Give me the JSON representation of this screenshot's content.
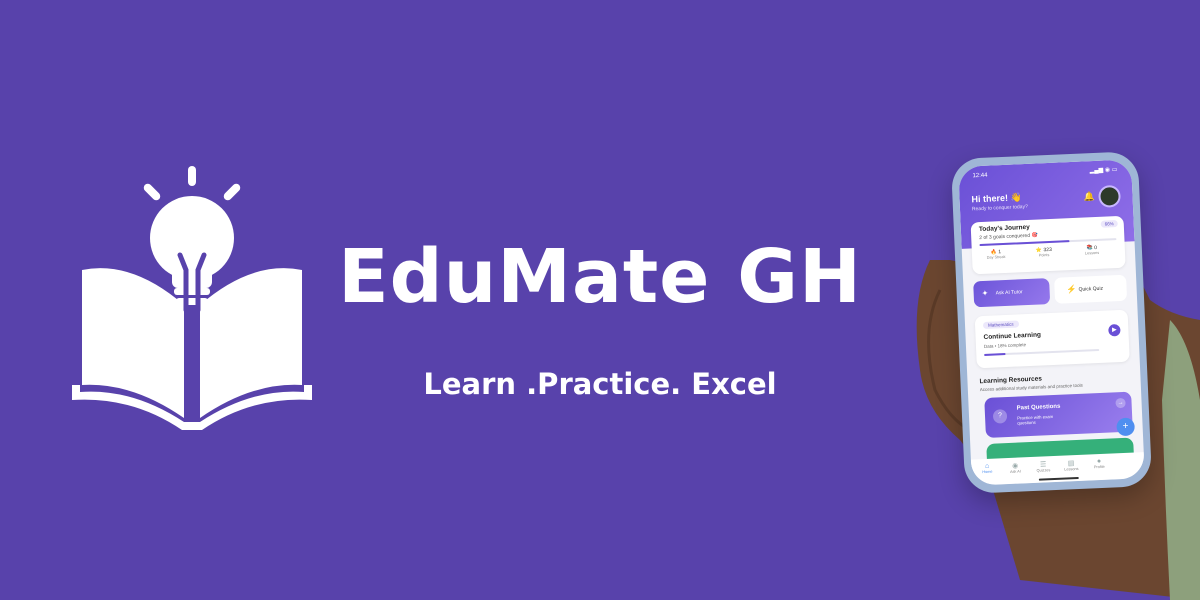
{
  "brand": {
    "title": "EduMate GH",
    "tagline": "Learn .Practice. Excel",
    "colors": {
      "background": "#5842ab",
      "text": "#ffffff",
      "accent": "#6a50d6"
    },
    "logo_icon": "lightbulb-book-icon"
  },
  "phone": {
    "status_time": "12:44",
    "greeting": "Hi there! 👋",
    "greeting_sub": "Ready to conquer today?",
    "journey": {
      "title": "Today's Journey",
      "subtitle": "2 of 3 goals conquered 🎯",
      "pill": "66%",
      "progress": 0.66,
      "stats": [
        {
          "value": "🔥 1",
          "label": "Day Streak"
        },
        {
          "value": "⭐ 323",
          "label": "Points"
        },
        {
          "value": "📚 0",
          "label": "Lessons"
        }
      ]
    },
    "actions": {
      "ask_tutor": "Ask AI Tutor",
      "quick_quiz": "Quick Quiz"
    },
    "continue": {
      "tag": "Mathematics",
      "title": "Continue Learning",
      "subtitle": "Data • 18% complete",
      "progress": 0.18
    },
    "resources": {
      "title": "Learning Resources",
      "subtitle": "Access additional study materials and practice tools",
      "past_questions_title": "Past Questions",
      "past_questions_sub": "Practice with exam questions"
    },
    "tabs": [
      "Home",
      "Ask AI",
      "Quizzes",
      "Lessons",
      "Profile"
    ]
  }
}
